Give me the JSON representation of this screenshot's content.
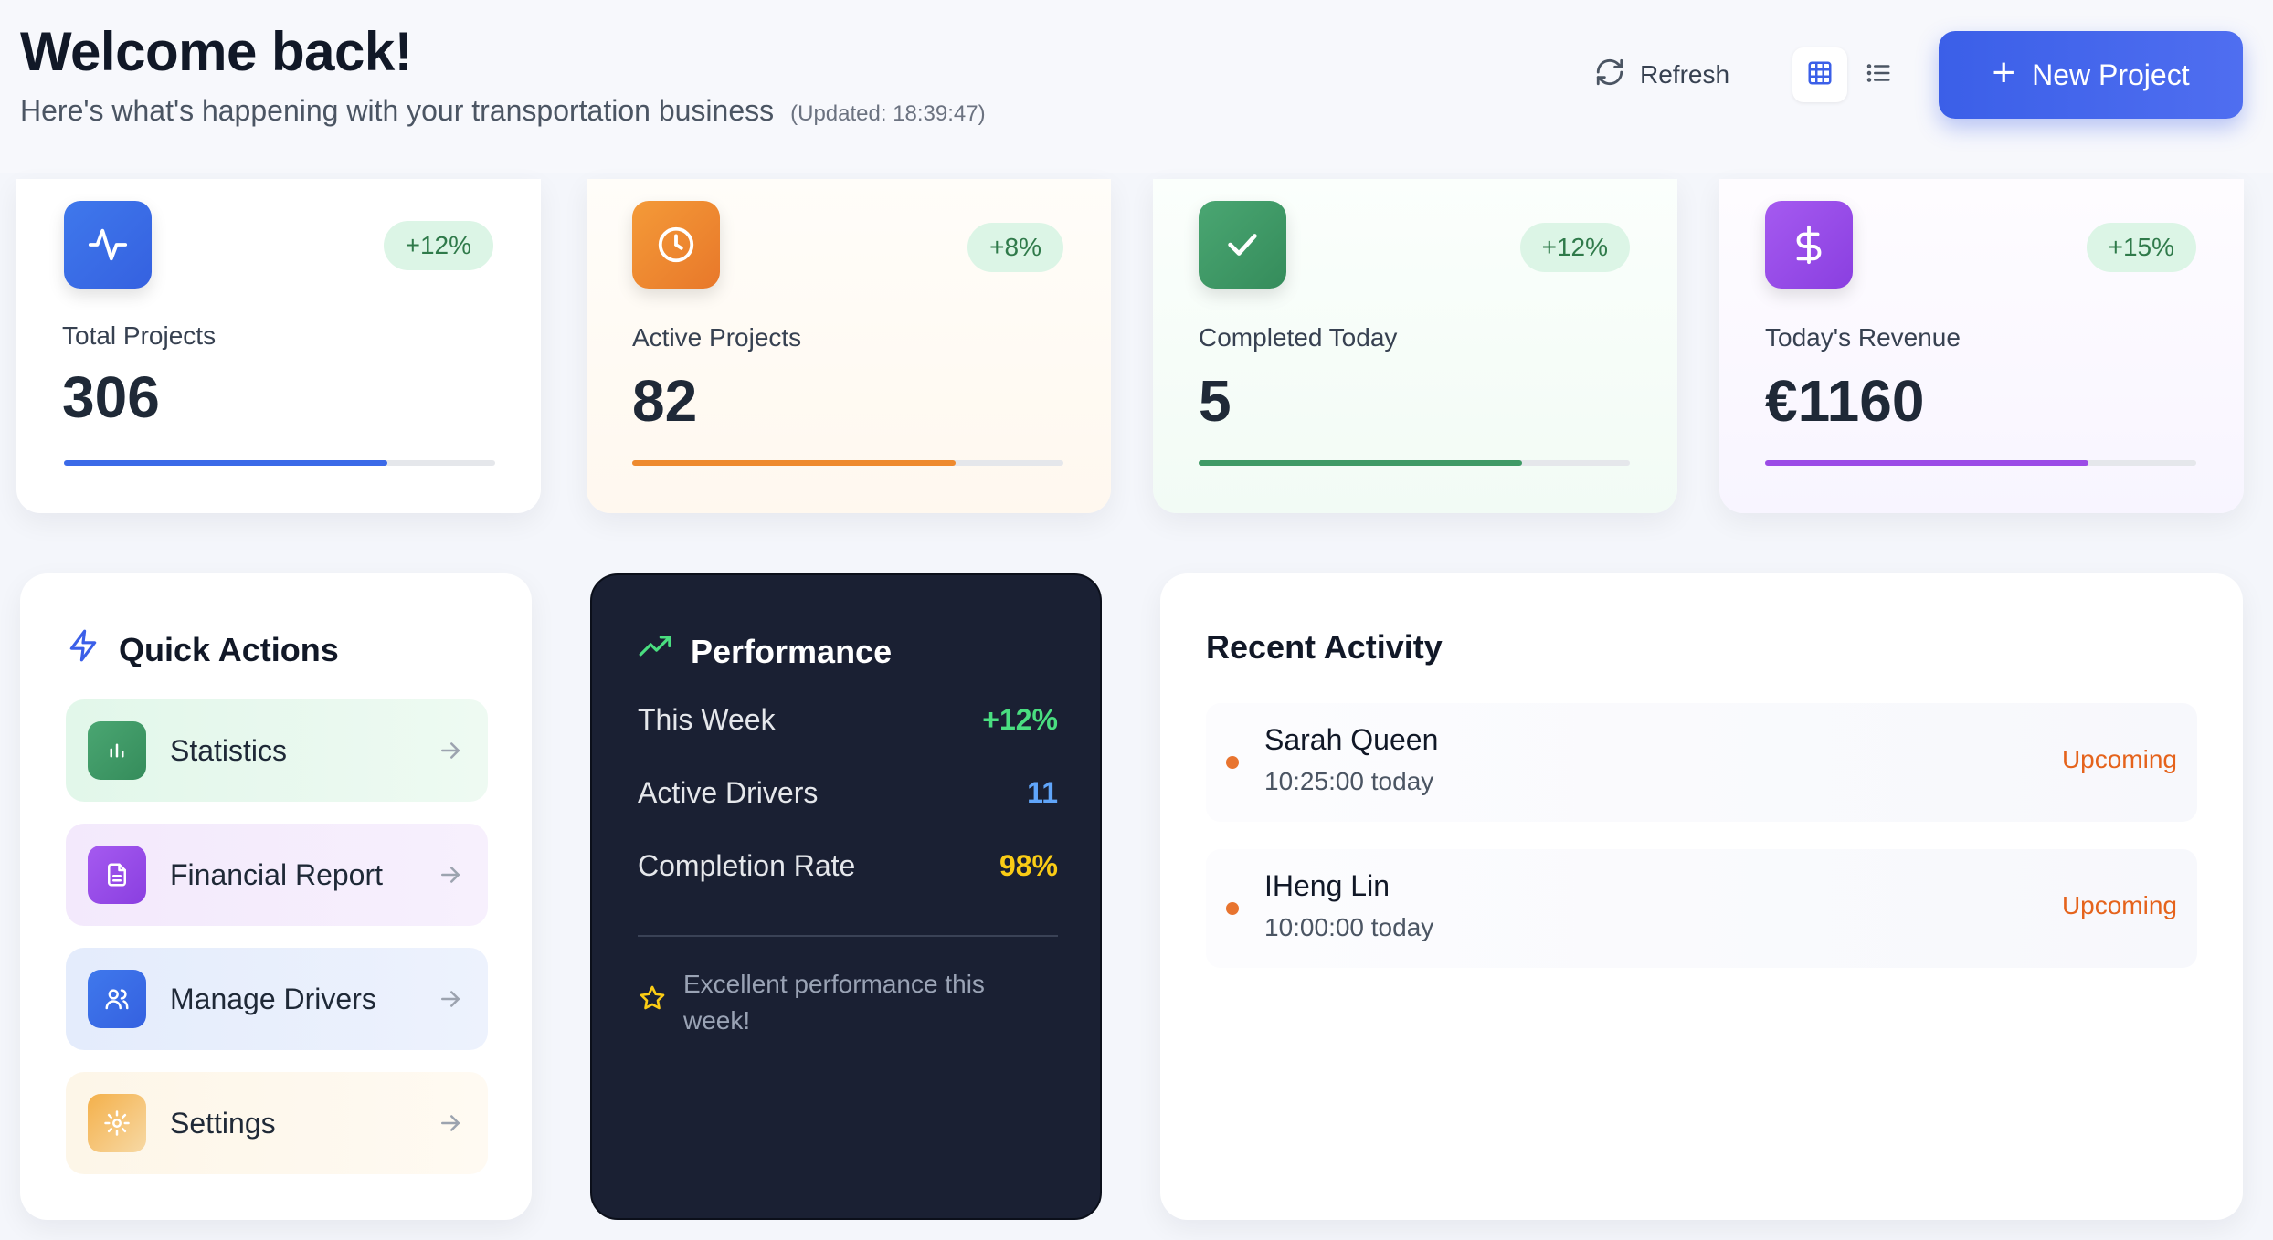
{
  "header": {
    "title": "Welcome back!",
    "subtitle": "Here's what's happening with your transportation business",
    "updated": "(Updated: 18:39:47)",
    "refresh_label": "Refresh",
    "new_project_label": "New Project",
    "view_modes": [
      "grid-icon",
      "list-icon"
    ],
    "active_view": "grid"
  },
  "stats": [
    {
      "label": "Total Projects",
      "value": "306",
      "change": "+12%",
      "icon": "activity-icon",
      "color": "#3b6ae8",
      "progress": 0.75
    },
    {
      "label": "Active Projects",
      "value": "82",
      "change": "+8%",
      "icon": "clock-icon",
      "color": "#ee8a2e",
      "progress": 0.75
    },
    {
      "label": "Completed Today",
      "value": "5",
      "change": "+12%",
      "icon": "check-icon",
      "color": "#3f9a66",
      "progress": 0.75
    },
    {
      "label": "Today's Revenue",
      "value": "€1160",
      "change": "+15%",
      "icon": "dollar-icon",
      "color": "#9b4be6",
      "progress": 0.75
    }
  ],
  "quick_actions": {
    "title": "Quick Actions",
    "items": [
      {
        "label": "Statistics",
        "icon": "bar-chart-icon"
      },
      {
        "label": "Financial Report",
        "icon": "document-icon"
      },
      {
        "label": "Manage Drivers",
        "icon": "users-icon"
      },
      {
        "label": "Settings",
        "icon": "gear-icon"
      }
    ]
  },
  "performance": {
    "title": "Performance",
    "rows": [
      {
        "label": "This Week",
        "value": "+12%",
        "color": "#4ade80"
      },
      {
        "label": "Active Drivers",
        "value": "11",
        "color": "#60a5fa"
      },
      {
        "label": "Completion Rate",
        "value": "98%",
        "color": "#facc15"
      }
    ],
    "note": "Excellent performance this week!"
  },
  "recent_activity": {
    "title": "Recent Activity",
    "items": [
      {
        "name": "Sarah Queen",
        "time": "10:25:00 today",
        "status": "Upcoming"
      },
      {
        "name": "IHeng Lin",
        "time": "10:00:00 today",
        "status": "Upcoming"
      }
    ]
  }
}
